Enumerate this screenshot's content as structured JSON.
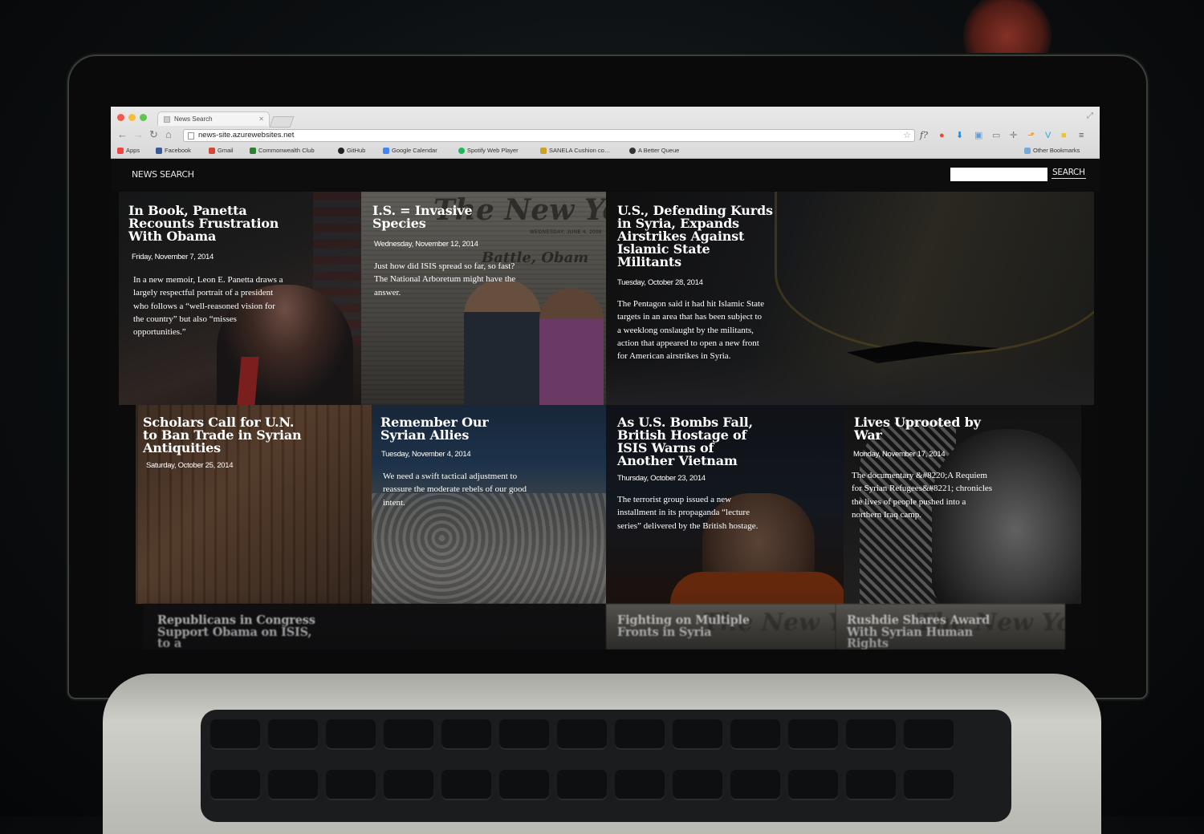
{
  "browser": {
    "tab_title": "News Search",
    "url": "news-site.azurewebsites.net",
    "bookmarks": [
      {
        "label": "Apps",
        "color": "#e44"
      },
      {
        "label": "Facebook",
        "color": "#3b5998"
      },
      {
        "label": "Gmail",
        "color": "#d44638"
      },
      {
        "label": "Commonwealth Club",
        "color": "#2e7d32"
      },
      {
        "label": "GitHub",
        "color": "#222222"
      },
      {
        "label": "Google Calendar",
        "color": "#4285f4"
      },
      {
        "label": "Spotify Web Player",
        "color": "#1db954"
      },
      {
        "label": "SANELA Cushion co…",
        "color": "#c9a227"
      },
      {
        "label": "A Better Queue",
        "color": "#333333"
      }
    ],
    "other_bookmarks": "Other Bookmarks"
  },
  "header": {
    "brand": "NEWS SEARCH",
    "search_value": "",
    "search_button": "SEARCH"
  },
  "articles": [
    {
      "title": "In Book, Panetta Recounts Frustration With Obama",
      "date": "Friday, November 7, 2014",
      "summary": "In a new memoir, Leon E. Panetta draws a largely respectful portrait of a president who follows a “well-reasoned vision for the country” but also “misses opportunities.”"
    },
    {
      "title": "I.S. = Invasive Species",
      "date": "Wednesday, November 12, 2014",
      "summary": "Just how did ISIS spread so far, so fast? The National Arboretum might have the answer."
    },
    {
      "title": "U.S., Defending Kurds in Syria, Expands Airstrikes Against Islamic State Militants",
      "date": "Tuesday, October 28, 2014",
      "summary": "The Pentagon said it had hit Islamic State targets in an area that has been subject to a weeklong onslaught by the militants, action that appeared to open a new front for American airstrikes in Syria."
    },
    {
      "title": "Scholars Call for U.N. to Ban Trade in Syrian Antiquities",
      "date": "Saturday, October 25, 2014",
      "summary": ""
    },
    {
      "title": "Remember Our Syrian Allies",
      "date": "Tuesday, November 4, 2014",
      "summary": "We need a swift tactical adjustment to reassure the moderate rebels of our good intent."
    },
    {
      "title": "As U.S. Bombs Fall, British Hostage of ISIS Warns of Another Vietnam",
      "date": "Thursday, October 23, 2014",
      "summary": "The terrorist group issued a new installment in its propaganda “lecture series” delivered by the British hostage."
    },
    {
      "title": "Lives Uprooted by War",
      "date": "Monday, November 17, 2014",
      "summary": "The documentary &#8220;A Requiem for Syrian Refugees&#8221; chronicles the lives of people pushed into a northern Iraq camp."
    },
    {
      "title": "Republicans in Congress Support Obama on ISIS, to a",
      "date": "",
      "summary": ""
    },
    {
      "title": "Fighting on Multiple Fronts in Syria",
      "date": "",
      "summary": ""
    },
    {
      "title": "Rushdie Shares Award With Syrian Human Rights",
      "date": "",
      "summary": ""
    }
  ],
  "decor": {
    "newspaper_masthead": "The New York",
    "newspaper_headline": "Battle, Obam",
    "newspaper_dateline": "WEDNESDAY, JUNE 4, 2008"
  }
}
